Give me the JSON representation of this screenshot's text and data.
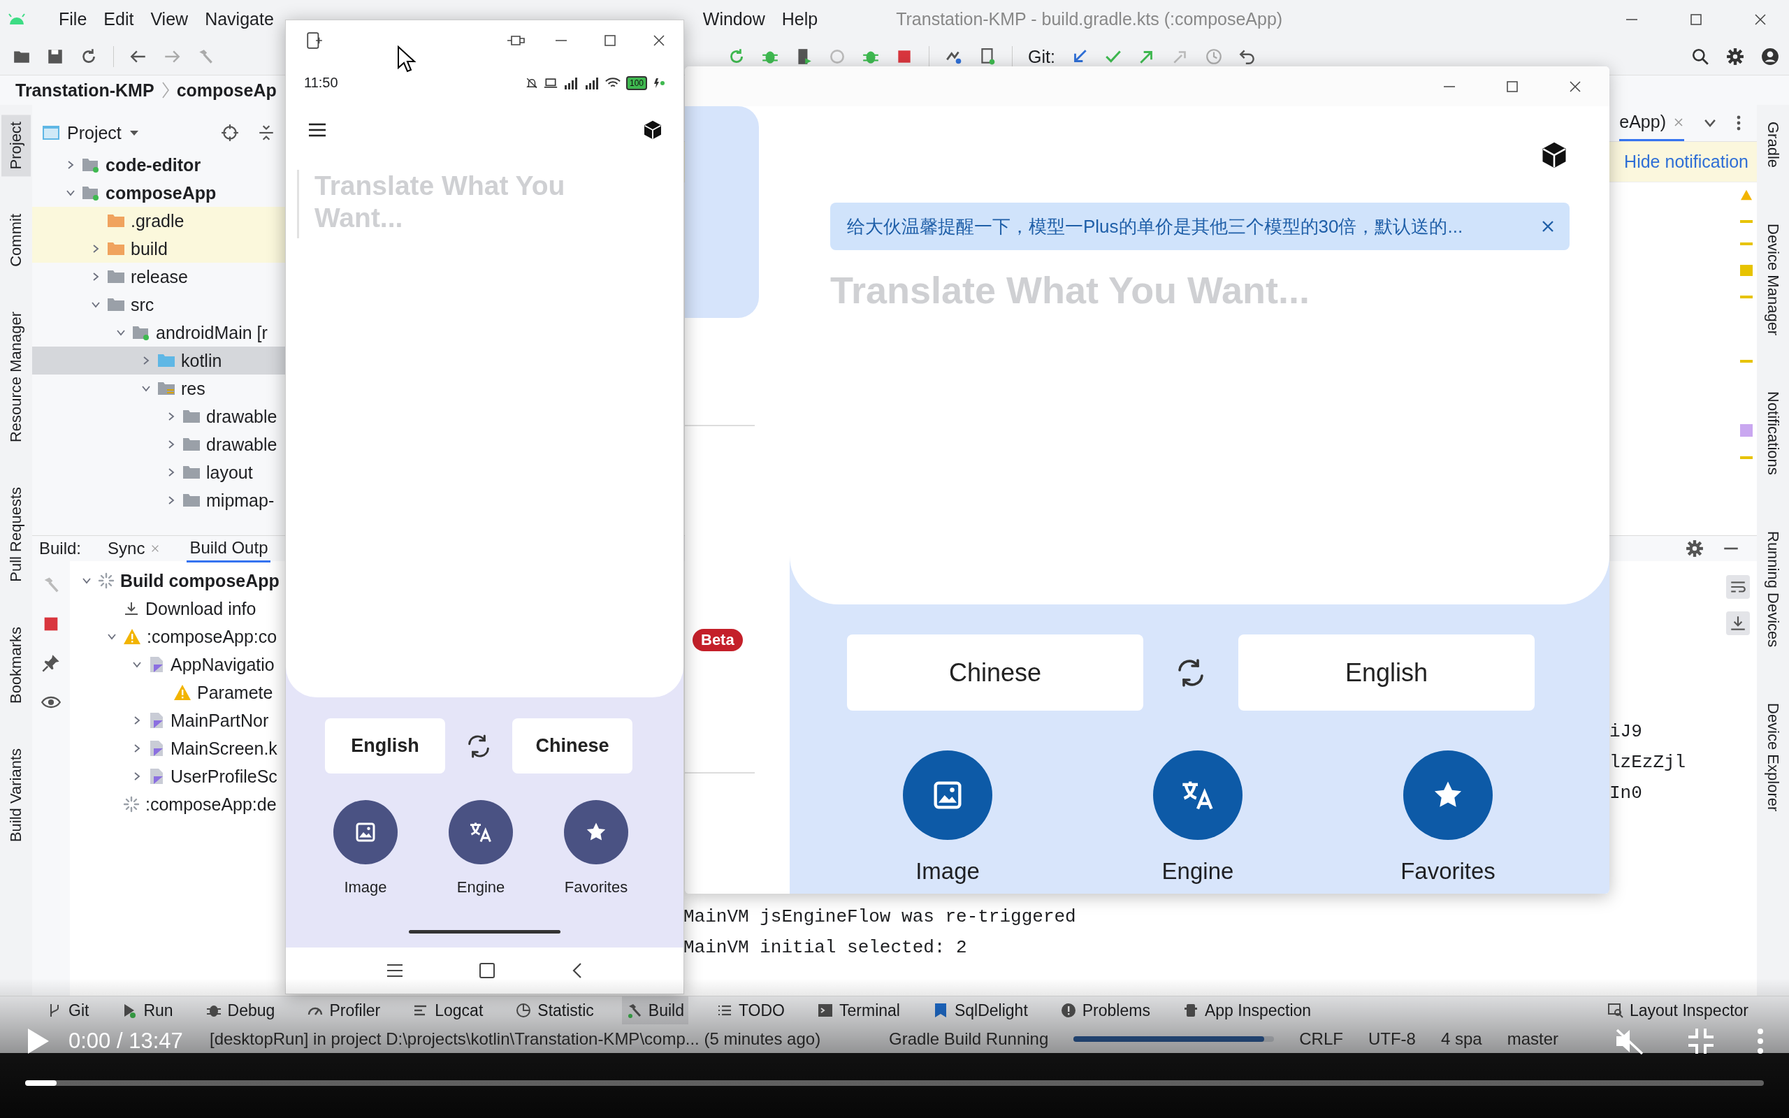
{
  "ide": {
    "menu": [
      "File",
      "Edit",
      "View",
      "Navigate"
    ],
    "menu_right": [
      "Window",
      "Help"
    ],
    "title": "Transtation-KMP - build.gradle.kts (:composeApp)",
    "git_label": "Git:",
    "breadcrumbs": [
      "Transtation-KMP",
      "composeAp"
    ],
    "left_strip": [
      {
        "label": "Project",
        "selected": true
      },
      {
        "label": "Commit",
        "selected": false
      },
      {
        "label": "Resource Manager",
        "selected": false
      },
      {
        "label": "Pull Requests",
        "selected": false
      },
      {
        "label": "Bookmarks",
        "selected": false
      },
      {
        "label": "Build Variants",
        "selected": false
      }
    ],
    "right_strip": [
      {
        "label": "Gradle",
        "selected": false
      },
      {
        "label": "Device Manager",
        "selected": false
      },
      {
        "label": "Notifications",
        "selected": false
      },
      {
        "label": "Running Devices",
        "selected": false
      },
      {
        "label": "Device Explorer",
        "selected": false
      }
    ],
    "project_panel": {
      "title": "Project",
      "tree": [
        {
          "label": "code-editor",
          "kind": "module",
          "expanded": false,
          "selected": false
        },
        {
          "label": "composeApp",
          "kind": "module",
          "expanded": true,
          "selected": false,
          "children": [
            {
              "label": ".gradle",
              "kind": "excluded",
              "selected": false
            },
            {
              "label": "build",
              "kind": "excluded",
              "expanded": false,
              "selected": false
            },
            {
              "label": "release",
              "kind": "folder",
              "expanded": false,
              "selected": false
            },
            {
              "label": "src",
              "kind": "folder",
              "expanded": true,
              "selected": false,
              "children": [
                {
                  "label": "androidMain [r",
                  "kind": "module",
                  "expanded": true,
                  "selected": false,
                  "children": [
                    {
                      "label": "kotlin",
                      "kind": "source",
                      "expanded": false,
                      "selected": true
                    },
                    {
                      "label": "res",
                      "kind": "resources",
                      "expanded": true,
                      "selected": false,
                      "children": [
                        {
                          "label": "drawable",
                          "kind": "folder",
                          "expanded": false,
                          "selected": false
                        },
                        {
                          "label": "drawable",
                          "kind": "folder",
                          "expanded": false,
                          "selected": false
                        },
                        {
                          "label": "layout",
                          "kind": "folder",
                          "expanded": false,
                          "selected": false
                        },
                        {
                          "label": "mipmap-",
                          "kind": "folder",
                          "expanded": false,
                          "selected": false
                        }
                      ]
                    }
                  ]
                }
              ]
            }
          ]
        }
      ]
    },
    "editor": {
      "tab": "eApp)",
      "notification_link": "Hide notification"
    },
    "build_panel": {
      "label": "Build:",
      "tabs": [
        {
          "label": "Sync",
          "closable": true,
          "selected": false
        },
        {
          "label": "Build Outp",
          "closable": false,
          "selected": true
        }
      ],
      "tree": [
        {
          "label": "Build composeApp",
          "kind": "running",
          "expanded": true,
          "children": [
            {
              "label": "Download info",
              "kind": "download"
            },
            {
              "label": ":composeApp:co",
              "kind": "warning",
              "expanded": true,
              "children": [
                {
                  "label": "AppNavigatio",
                  "kind": "kotlin-file",
                  "expanded": true,
                  "children": [
                    {
                      "label": "Paramete",
                      "kind": "warning"
                    }
                  ]
                },
                {
                  "label": "MainPartNor",
                  "kind": "kotlin-file",
                  "expanded": false
                },
                {
                  "label": "MainScreen.k",
                  "kind": "kotlin-file",
                  "expanded": false
                },
                {
                  "label": "UserProfileSc",
                  "kind": "kotlin-file",
                  "expanded": false
                }
              ]
            },
            {
              "label": ":composeApp:de",
              "kind": "running"
            }
          ]
        }
      ],
      "console_fragments": [
        "iJ9",
        "lzEzZjl",
        "In0"
      ],
      "console": [
        "MainVM jsEngineFlow was re-triggered",
        "MainVM initial selected: 2"
      ]
    },
    "tool_tabs": [
      {
        "label": "Git",
        "kind": "git",
        "selected": false
      },
      {
        "label": "Run",
        "kind": "run",
        "selected": false
      },
      {
        "label": "Debug",
        "kind": "debug",
        "selected": false
      },
      {
        "label": "Profiler",
        "kind": "profiler",
        "selected": false
      },
      {
        "label": "Logcat",
        "kind": "logcat",
        "selected": false
      },
      {
        "label": "Statistic",
        "kind": "statistic",
        "selected": false
      },
      {
        "label": "Build",
        "kind": "build",
        "selected": true
      },
      {
        "label": "TODO",
        "kind": "todo",
        "selected": false
      },
      {
        "label": "Terminal",
        "kind": "terminal",
        "selected": false
      },
      {
        "label": "SqlDelight",
        "kind": "sqldelight",
        "selected": false
      },
      {
        "label": "Problems",
        "kind": "problems",
        "selected": false
      },
      {
        "label": "App Inspection",
        "kind": "inspection",
        "selected": false
      }
    ],
    "tool_tabs_right": [
      {
        "label": "Layout Inspector",
        "kind": "layout",
        "selected": false
      }
    ],
    "status_bar": {
      "message": "[desktopRun] in project D:\\projects\\kotlin\\Transtation-KMP\\comp... (5 minutes ago)",
      "task": "Gradle Build Running",
      "level": 0.95,
      "items": [
        "CRLF",
        "UTF-8",
        "4 spa",
        "master"
      ]
    }
  },
  "emulator": {
    "clock": "11:50",
    "battery": "100",
    "placeholder": "Translate What You Want...",
    "languages": [
      "English",
      "Chinese"
    ],
    "actions": [
      {
        "kind": "image",
        "label": "Image"
      },
      {
        "kind": "engine",
        "label": "Engine"
      },
      {
        "kind": "favorites",
        "label": "Favorites"
      }
    ]
  },
  "desktop_app": {
    "badge": "Beta",
    "notification": "给大伙温馨提醒一下，模型一Plus的单价是其他三个模型的30倍，默认送的...",
    "placeholder": "Translate What You Want...",
    "languages": [
      "Chinese",
      "English"
    ],
    "actions": [
      {
        "kind": "image",
        "label": "Image"
      },
      {
        "kind": "engine",
        "label": "Engine"
      },
      {
        "kind": "favorites",
        "label": "Favorites"
      }
    ]
  },
  "video": {
    "time": "0:00 / 13:47",
    "level": 0.018
  }
}
